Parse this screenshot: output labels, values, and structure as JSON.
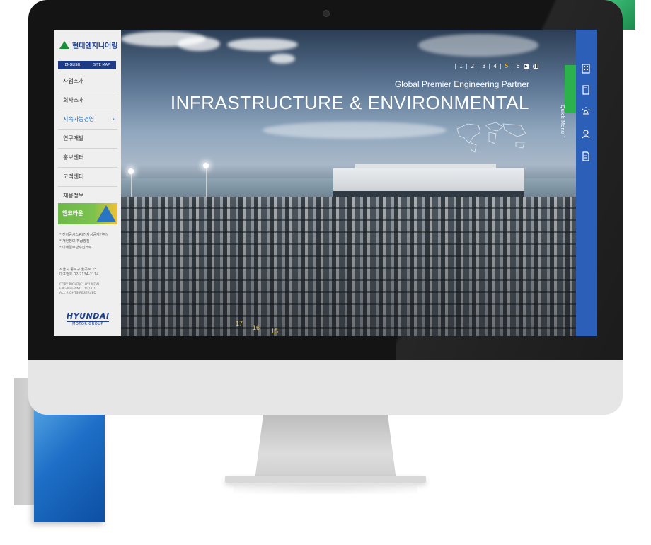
{
  "sidebar": {
    "logo_text": "현대엔지니어링",
    "lang": [
      "ENGLISH",
      "SITE MAP"
    ],
    "nav": [
      {
        "label": "사업소개"
      },
      {
        "label": "회사소개"
      },
      {
        "label": "지속가능경영"
      },
      {
        "label": "연구개발"
      },
      {
        "label": "홍보센터"
      },
      {
        "label": "고객센터"
      },
      {
        "label": "채용정보"
      }
    ],
    "eco_label": "엠코타운",
    "policy_links": [
      "* 전자공시스템(전자상공게인지)",
      "* 개인정보 취급방침",
      "* 이메일무단수집거부"
    ],
    "address": [
      "서울시 종로구 율곡로 75",
      "대표번호 02-2134-2114"
    ],
    "copyright": [
      "COPY RIGHT(C) HYUNDAI",
      "ENGINEERING CO.,LTD.",
      "ALL RIGHTS RESERVED"
    ],
    "group_logo_main": "HYUNDAI",
    "group_logo_sub": "MOTOR GROUP"
  },
  "hero": {
    "tagline": "Global Premier Engineering Partner",
    "headline": "INFRASTRUCTURE & ENVIRONMENTAL",
    "pager": {
      "pages": [
        "1",
        "2",
        "3",
        "4",
        "5",
        "6"
      ],
      "active": "5"
    },
    "parking_numbers": [
      "17",
      "16",
      "15"
    ]
  },
  "quick_menu": {
    "label": "Quick Menu",
    "icons": [
      "building-icon",
      "book-icon",
      "lamp-icon",
      "user-icon",
      "document-icon"
    ]
  },
  "colors": {
    "nav_active": "#1d6dbf",
    "quick_green": "#2bb24c",
    "panel_blue": "#2c5fb8",
    "brand_blue": "#1d3f8c"
  }
}
